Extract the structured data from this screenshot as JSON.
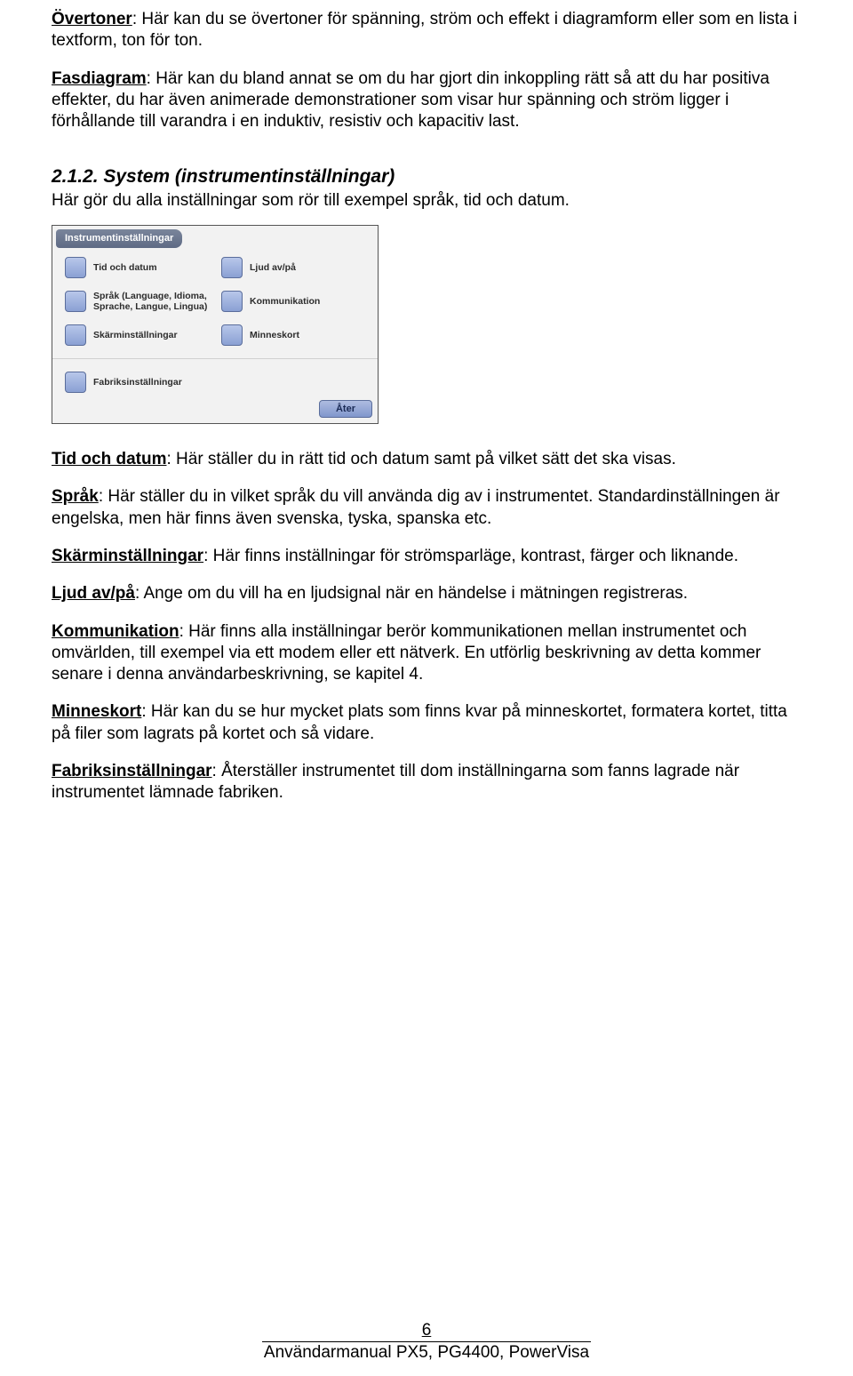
{
  "para1": {
    "label": "Övertoner",
    "text": ": Här kan du se övertoner för spänning, ström och effekt i diagramform eller som en lista i textform, ton för ton."
  },
  "para2": {
    "label": "Fasdiagram",
    "text": ": Här kan du bland annat se om du har gjort din inkoppling rätt så att du har positiva effekter, du har även animerade demonstrationer som visar hur spänning och ström ligger i förhållande till varandra i en induktiv, resistiv och kapacitiv last."
  },
  "heading": "2.1.2.  System (instrumentinställningar)",
  "headingSub": "Här gör du alla inställningar som rör till exempel språk, tid och datum.",
  "panel": {
    "title": "Instrumentinställningar",
    "items": [
      "Tid och datum",
      "Ljud av/på",
      "Språk (Language, Idioma, Sprache, Langue, Lingua)",
      "Kommunikation",
      "Skärminställningar",
      "Minneskort"
    ],
    "lastItem": "Fabriksinställningar",
    "backBtn": "Åter"
  },
  "desc": [
    {
      "label": "Tid och datum",
      "text": ": Här ställer du in rätt tid och datum samt på vilket sätt det ska visas."
    },
    {
      "label": "Språk",
      "text": ": Här ställer du in vilket språk du vill använda dig av i instrumentet. Standardinställningen är engelska, men här finns även svenska, tyska, spanska etc."
    },
    {
      "label": "Skärminställningar",
      "text": ": Här finns inställningar för strömsparläge, kontrast, färger och liknande."
    },
    {
      "label": "Ljud av/på",
      "text": ": Ange om du vill ha en ljudsignal när en händelse i mätningen registreras."
    },
    {
      "label": "Kommunikation",
      "text": ": Här finns alla inställningar berör kommunikationen mellan instrumentet och omvärlden, till exempel via ett modem eller ett nätverk. En utförlig beskrivning av detta kommer senare i denna användarbeskrivning, se kapitel 4."
    },
    {
      "label": "Minneskort",
      "text": ": Här kan du se hur mycket plats som finns kvar på minneskortet, formatera kortet, titta på filer som lagrats på kortet och så vidare."
    },
    {
      "label": "Fabriksinställningar",
      "text": ": Återställer instrumentet till dom inställningarna som fanns lagrade när instrumentet lämnade fabriken."
    }
  ],
  "footer": {
    "page": "6",
    "title": "Användarmanual PX5, PG4400, PowerVisa"
  }
}
